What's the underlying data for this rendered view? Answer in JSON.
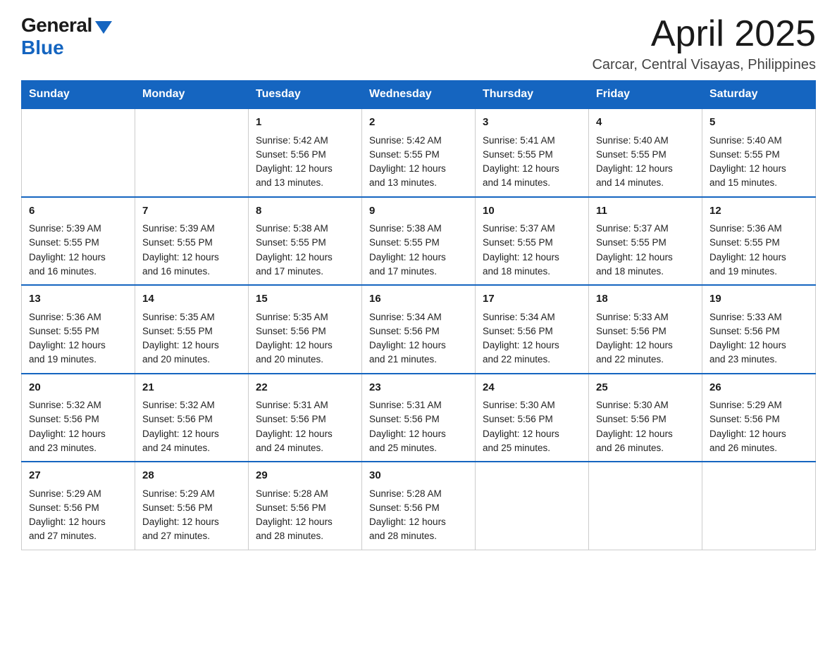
{
  "logo": {
    "general": "General",
    "blue": "Blue"
  },
  "title": "April 2025",
  "location": "Carcar, Central Visayas, Philippines",
  "days_of_week": [
    "Sunday",
    "Monday",
    "Tuesday",
    "Wednesday",
    "Thursday",
    "Friday",
    "Saturday"
  ],
  "weeks": [
    [
      {
        "day": "",
        "info": ""
      },
      {
        "day": "",
        "info": ""
      },
      {
        "day": "1",
        "info": "Sunrise: 5:42 AM\nSunset: 5:56 PM\nDaylight: 12 hours\nand 13 minutes."
      },
      {
        "day": "2",
        "info": "Sunrise: 5:42 AM\nSunset: 5:55 PM\nDaylight: 12 hours\nand 13 minutes."
      },
      {
        "day": "3",
        "info": "Sunrise: 5:41 AM\nSunset: 5:55 PM\nDaylight: 12 hours\nand 14 minutes."
      },
      {
        "day": "4",
        "info": "Sunrise: 5:40 AM\nSunset: 5:55 PM\nDaylight: 12 hours\nand 14 minutes."
      },
      {
        "day": "5",
        "info": "Sunrise: 5:40 AM\nSunset: 5:55 PM\nDaylight: 12 hours\nand 15 minutes."
      }
    ],
    [
      {
        "day": "6",
        "info": "Sunrise: 5:39 AM\nSunset: 5:55 PM\nDaylight: 12 hours\nand 16 minutes."
      },
      {
        "day": "7",
        "info": "Sunrise: 5:39 AM\nSunset: 5:55 PM\nDaylight: 12 hours\nand 16 minutes."
      },
      {
        "day": "8",
        "info": "Sunrise: 5:38 AM\nSunset: 5:55 PM\nDaylight: 12 hours\nand 17 minutes."
      },
      {
        "day": "9",
        "info": "Sunrise: 5:38 AM\nSunset: 5:55 PM\nDaylight: 12 hours\nand 17 minutes."
      },
      {
        "day": "10",
        "info": "Sunrise: 5:37 AM\nSunset: 5:55 PM\nDaylight: 12 hours\nand 18 minutes."
      },
      {
        "day": "11",
        "info": "Sunrise: 5:37 AM\nSunset: 5:55 PM\nDaylight: 12 hours\nand 18 minutes."
      },
      {
        "day": "12",
        "info": "Sunrise: 5:36 AM\nSunset: 5:55 PM\nDaylight: 12 hours\nand 19 minutes."
      }
    ],
    [
      {
        "day": "13",
        "info": "Sunrise: 5:36 AM\nSunset: 5:55 PM\nDaylight: 12 hours\nand 19 minutes."
      },
      {
        "day": "14",
        "info": "Sunrise: 5:35 AM\nSunset: 5:55 PM\nDaylight: 12 hours\nand 20 minutes."
      },
      {
        "day": "15",
        "info": "Sunrise: 5:35 AM\nSunset: 5:56 PM\nDaylight: 12 hours\nand 20 minutes."
      },
      {
        "day": "16",
        "info": "Sunrise: 5:34 AM\nSunset: 5:56 PM\nDaylight: 12 hours\nand 21 minutes."
      },
      {
        "day": "17",
        "info": "Sunrise: 5:34 AM\nSunset: 5:56 PM\nDaylight: 12 hours\nand 22 minutes."
      },
      {
        "day": "18",
        "info": "Sunrise: 5:33 AM\nSunset: 5:56 PM\nDaylight: 12 hours\nand 22 minutes."
      },
      {
        "day": "19",
        "info": "Sunrise: 5:33 AM\nSunset: 5:56 PM\nDaylight: 12 hours\nand 23 minutes."
      }
    ],
    [
      {
        "day": "20",
        "info": "Sunrise: 5:32 AM\nSunset: 5:56 PM\nDaylight: 12 hours\nand 23 minutes."
      },
      {
        "day": "21",
        "info": "Sunrise: 5:32 AM\nSunset: 5:56 PM\nDaylight: 12 hours\nand 24 minutes."
      },
      {
        "day": "22",
        "info": "Sunrise: 5:31 AM\nSunset: 5:56 PM\nDaylight: 12 hours\nand 24 minutes."
      },
      {
        "day": "23",
        "info": "Sunrise: 5:31 AM\nSunset: 5:56 PM\nDaylight: 12 hours\nand 25 minutes."
      },
      {
        "day": "24",
        "info": "Sunrise: 5:30 AM\nSunset: 5:56 PM\nDaylight: 12 hours\nand 25 minutes."
      },
      {
        "day": "25",
        "info": "Sunrise: 5:30 AM\nSunset: 5:56 PM\nDaylight: 12 hours\nand 26 minutes."
      },
      {
        "day": "26",
        "info": "Sunrise: 5:29 AM\nSunset: 5:56 PM\nDaylight: 12 hours\nand 26 minutes."
      }
    ],
    [
      {
        "day": "27",
        "info": "Sunrise: 5:29 AM\nSunset: 5:56 PM\nDaylight: 12 hours\nand 27 minutes."
      },
      {
        "day": "28",
        "info": "Sunrise: 5:29 AM\nSunset: 5:56 PM\nDaylight: 12 hours\nand 27 minutes."
      },
      {
        "day": "29",
        "info": "Sunrise: 5:28 AM\nSunset: 5:56 PM\nDaylight: 12 hours\nand 28 minutes."
      },
      {
        "day": "30",
        "info": "Sunrise: 5:28 AM\nSunset: 5:56 PM\nDaylight: 12 hours\nand 28 minutes."
      },
      {
        "day": "",
        "info": ""
      },
      {
        "day": "",
        "info": ""
      },
      {
        "day": "",
        "info": ""
      }
    ]
  ]
}
